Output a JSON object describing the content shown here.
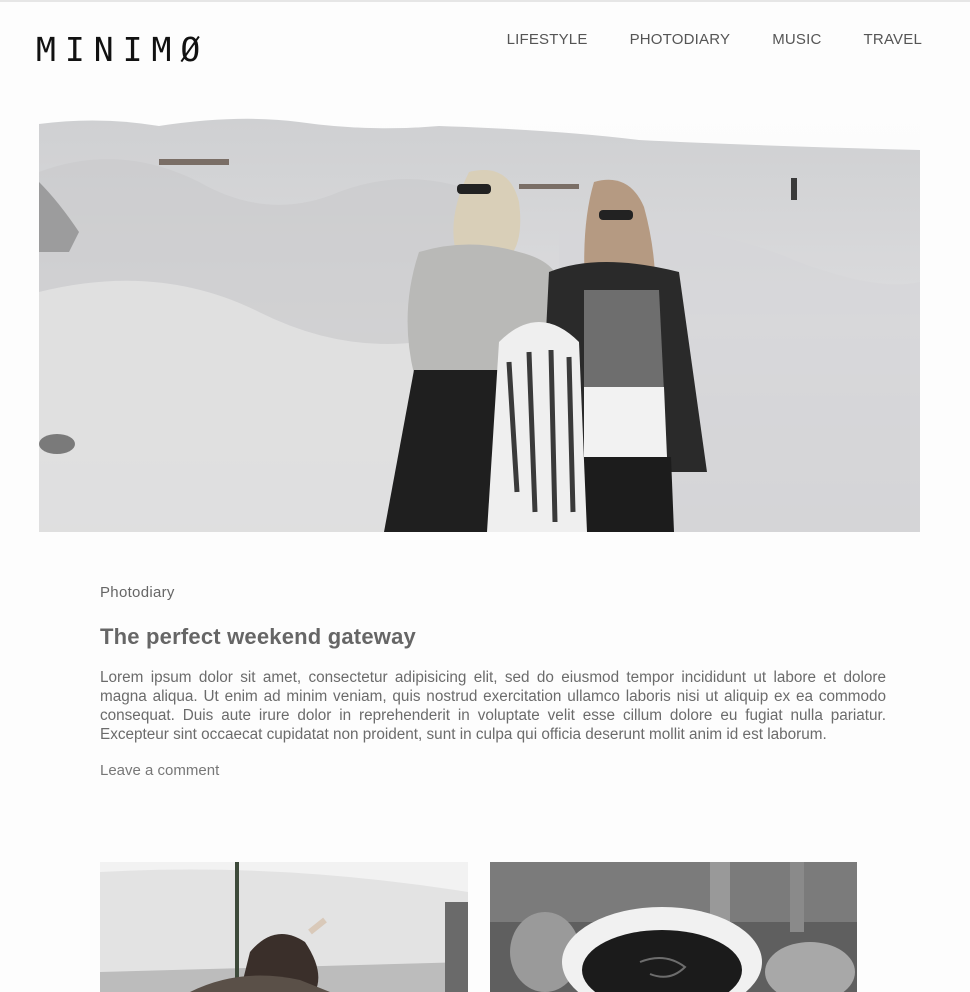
{
  "site": {
    "logo": "MINIMØ"
  },
  "nav": {
    "items": [
      {
        "label": "LIFESTYLE"
      },
      {
        "label": "PHOTODIARY"
      },
      {
        "label": "MUSIC"
      },
      {
        "label": "TRAVEL"
      }
    ]
  },
  "post": {
    "category": "Photodiary",
    "title": "The perfect weekend gateway",
    "excerpt": "Lorem ipsum dolor sit amet, consectetur adipisicing elit, sed do eiusmod tempor incididunt ut labore et dolore magna aliqua. Ut enim ad minim veniam, quis nostrud exercitation ullamco laboris nisi ut aliquip ex ea commodo consequat. Duis aute irure dolor in reprehenderit in voluptate velit esse cillum dolore eu fugiat nulla pariatur. Excepteur sint occaecat cupidatat non proident, sunt in culpa qui officia deserunt mollit anim id est laborum.",
    "comment_link": "Leave a comment"
  },
  "colors": {
    "text": "#444444",
    "muted": "#666666",
    "background": "#fdfdfd"
  }
}
